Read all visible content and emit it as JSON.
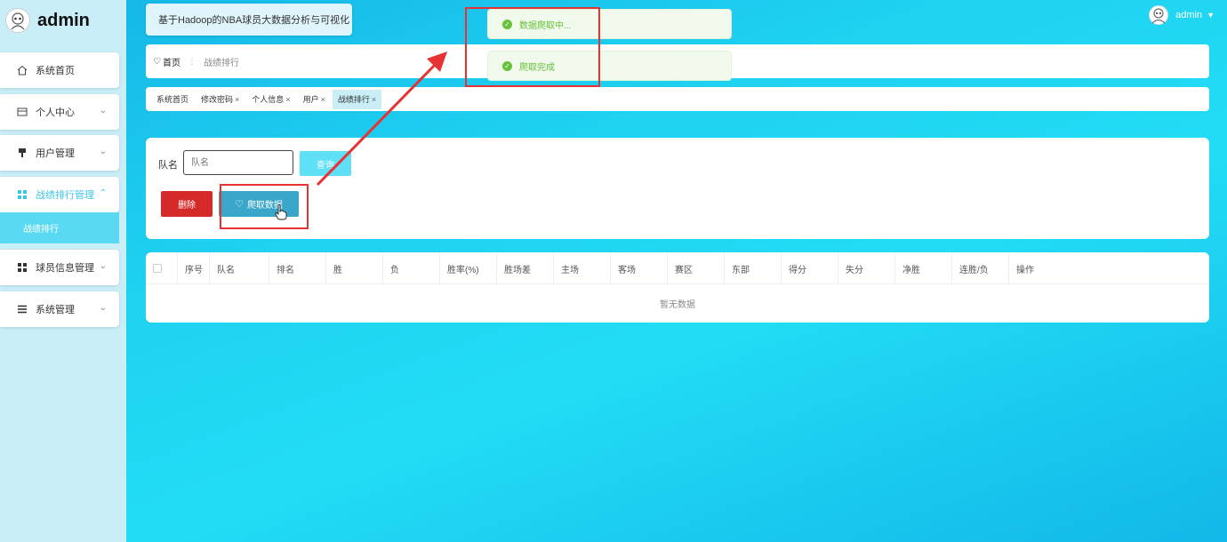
{
  "sidebar": {
    "brand": "admin",
    "items": [
      {
        "label": "系统首页",
        "icon": "home-icon",
        "has_chevron": false
      },
      {
        "label": "个人中心",
        "icon": "card-icon",
        "has_chevron": true
      },
      {
        "label": "用户管理",
        "icon": "user-manage-icon",
        "has_chevron": true
      },
      {
        "label": "战绩排行管理",
        "icon": "grid-icon",
        "has_chevron": true,
        "active": true
      },
      {
        "label": "球员信息管理",
        "icon": "grid-icon",
        "has_chevron": true
      },
      {
        "label": "系统管理",
        "icon": "list-icon",
        "has_chevron": true
      }
    ],
    "sub_item": "战绩排行"
  },
  "header": {
    "system_title": "基于Hadoop的NBA球员大数据分析与可视化",
    "username": "admin"
  },
  "breadcrumb": {
    "home": "首页",
    "separator": "⋮",
    "current": "战绩排行"
  },
  "tabs": [
    {
      "label": "系统首页",
      "closable": false
    },
    {
      "label": "修改密码",
      "closable": true
    },
    {
      "label": "个人信息",
      "closable": true
    },
    {
      "label": "用户",
      "closable": true
    },
    {
      "label": "战绩排行",
      "closable": true,
      "active": true
    }
  ],
  "notifications": [
    {
      "text": "数据爬取中..."
    },
    {
      "text": "爬取完成"
    }
  ],
  "search": {
    "label": "队名",
    "placeholder": "队名",
    "query_button": "查询"
  },
  "actions": {
    "delete_button": "删除",
    "crawl_button": "爬取数据"
  },
  "table": {
    "columns": [
      "序号",
      "队名",
      "排名",
      "胜",
      "负",
      "胜率(%)",
      "胜场差",
      "主场",
      "客场",
      "赛区",
      "东部",
      "得分",
      "失分",
      "净胜",
      "连胜/负",
      "操作"
    ],
    "empty_text": "暂无数据"
  },
  "colors": {
    "accent": "#3cc6e6",
    "danger": "#d62a2a",
    "success": "#67c23a",
    "annotation": "#e63232"
  }
}
